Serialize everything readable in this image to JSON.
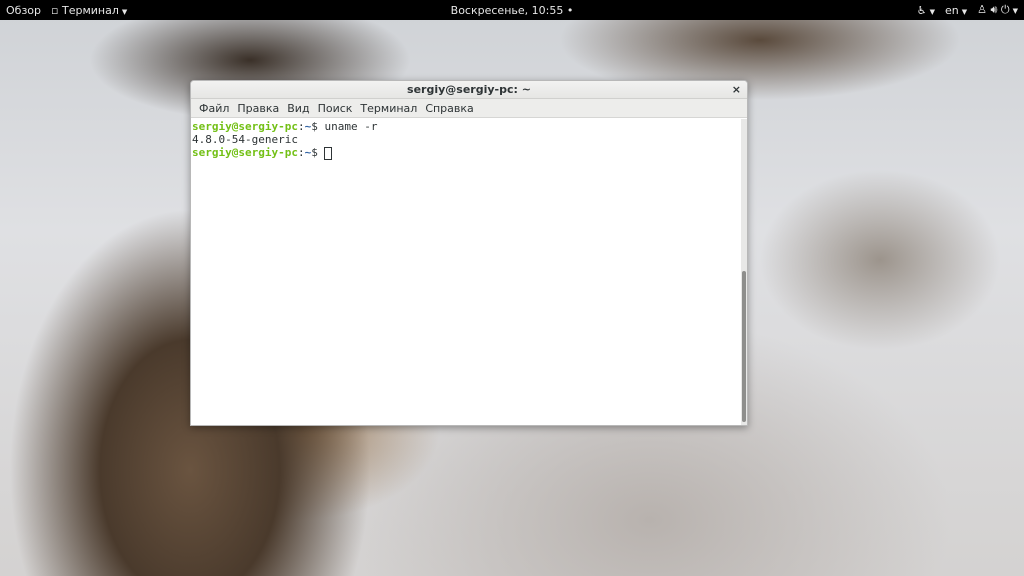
{
  "topbar": {
    "activities": "Обзор",
    "app_menu": "Терминал",
    "clock": "Воскресенье, 10:55",
    "language": "en"
  },
  "terminal": {
    "title": "sergiy@sergiy-pc: ~",
    "close": "×",
    "menu": [
      "Файл",
      "Правка",
      "Вид",
      "Поиск",
      "Терминал",
      "Справка"
    ],
    "lines": [
      {
        "user": "sergiy@sergiy-pc",
        "sep": ":",
        "dir": "~",
        "prompt": "$ ",
        "cmd": "uname -r"
      },
      {
        "output": "4.8.0-54-generic"
      },
      {
        "user": "sergiy@sergiy-pc",
        "sep": ":",
        "dir": "~",
        "prompt": "$ ",
        "cmd": ""
      }
    ]
  },
  "colors": {
    "prompt_user": "#73c016",
    "prompt_dir": "#3465a4"
  }
}
